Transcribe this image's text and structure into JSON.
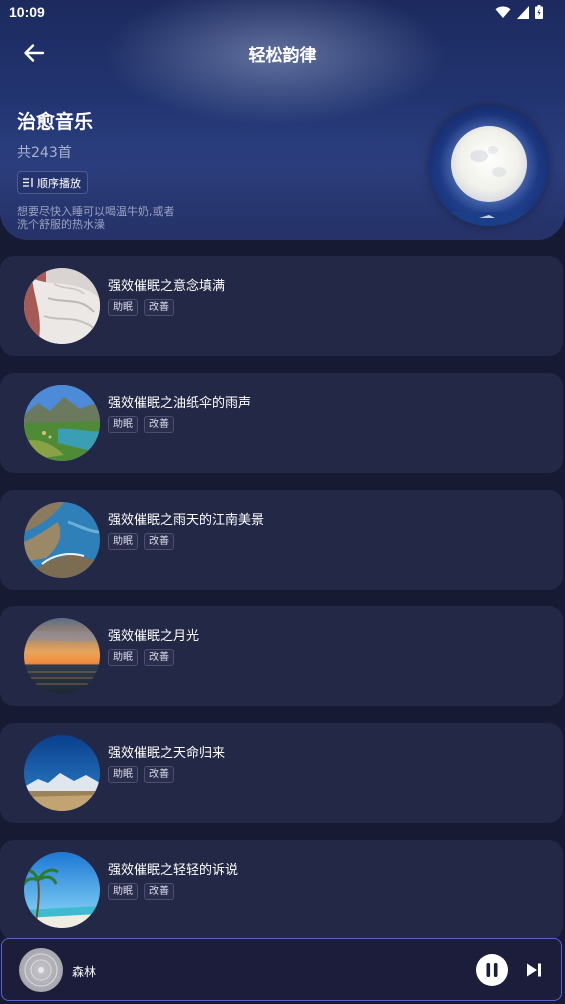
{
  "status_bar": {
    "time": "10:09",
    "icons": [
      "wifi-icon",
      "signal-icon",
      "battery-icon"
    ]
  },
  "header": {
    "title": "轻松韵律",
    "back_icon": "back-arrow-icon"
  },
  "playlist": {
    "title": "治愈音乐",
    "count": "共243首",
    "play_order_label": "顺序播放",
    "play_order_icon": "list-order-icon",
    "description": "想要尽快入睡可以喝温牛奶,或者洗个舒服的热水澡"
  },
  "songs": [
    {
      "title": "强效催眠之意念填满",
      "tags": [
        "助眠",
        "改善"
      ],
      "image": "bedsheet-photo"
    },
    {
      "title": "强效催眠之油纸伞的雨声",
      "tags": [
        "助眠",
        "改善"
      ],
      "image": "mountain-lake-photo"
    },
    {
      "title": "强效催眠之雨天的江南美景",
      "tags": [
        "助眠",
        "改善"
      ],
      "image": "coastline-photo"
    },
    {
      "title": "强效催眠之月光",
      "tags": [
        "助眠",
        "改善"
      ],
      "image": "sunset-sea-photo"
    },
    {
      "title": "强效催眠之天命归来",
      "tags": [
        "助眠",
        "改善"
      ],
      "image": "blue-sky-mountain-photo"
    },
    {
      "title": "强效催眠之轻轻的诉说",
      "tags": [
        "助眠",
        "改善"
      ],
      "image": "palm-beach-photo"
    }
  ],
  "mini_player": {
    "title": "森林",
    "pause_icon": "pause-icon",
    "next_icon": "skip-next-icon"
  },
  "colors": {
    "background": "#171a33",
    "card": "#242847",
    "accent_border": "#5a63c8"
  }
}
